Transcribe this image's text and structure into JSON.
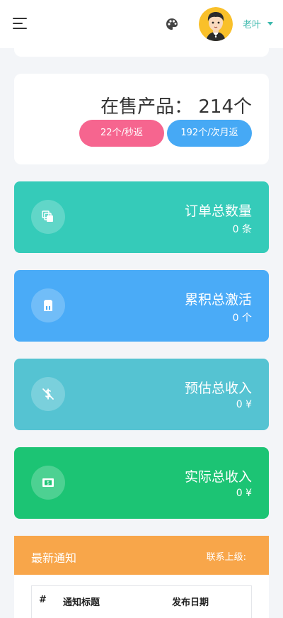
{
  "header": {
    "user_name": "老叶",
    "menu_icon": "hamburger-menu-icon",
    "theme_icon": "palette-icon"
  },
  "product": {
    "title": "在售产品： 214个",
    "badge_instant": "22个/秒返",
    "badge_monthly": "192个/次月返"
  },
  "stats": {
    "orders": {
      "label": "订单总数量",
      "value": "0 条",
      "color": "#35cbb9",
      "icon": "copy-icon"
    },
    "activations": {
      "label": "累积总激活",
      "value": "0 个",
      "color": "#4aabf7",
      "icon": "sim-card-icon"
    },
    "estimated_income": {
      "label": "预估总收入",
      "value": "0 ¥",
      "color": "#55c3d2",
      "icon": "dollar-off-icon"
    },
    "actual_income": {
      "label": "实际总收入",
      "value": "0 ¥",
      "color": "#1cc474",
      "icon": "banknote-icon"
    }
  },
  "notices": {
    "title": "最新通知",
    "contact": "联系上级:",
    "columns": [
      "#",
      "通知标题",
      "发布日期"
    ]
  },
  "colors": {
    "accent": "#3bb8ac",
    "pink": "#f6658f",
    "blue": "#46a9f5",
    "orange": "#f8a64a"
  }
}
